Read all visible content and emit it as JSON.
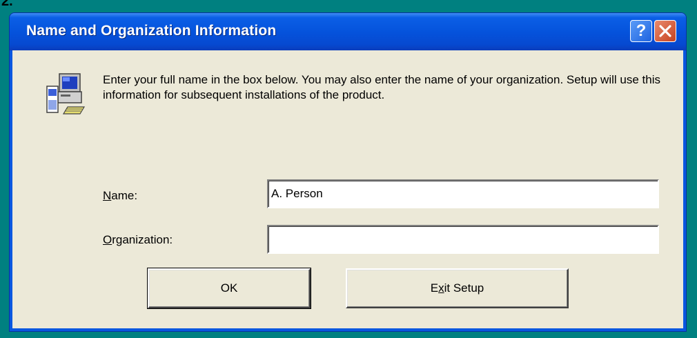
{
  "corner_text": "2.",
  "dialog": {
    "title": "Name and Organization Information",
    "help_label": "?",
    "message": "Enter your full name in the box below. You may also enter the name of your organization. Setup will use this information for subsequent installations of the product.",
    "name_field": {
      "label_access_key": "N",
      "label_rest": "ame:",
      "value": "A. Person"
    },
    "organization_field": {
      "label_access_key": "O",
      "label_rest": "rganization:",
      "value": ""
    },
    "ok_button": {
      "label": "OK"
    },
    "exit_button": {
      "label_before": "E",
      "label_access_key": "x",
      "label_after": "it Setup"
    }
  }
}
